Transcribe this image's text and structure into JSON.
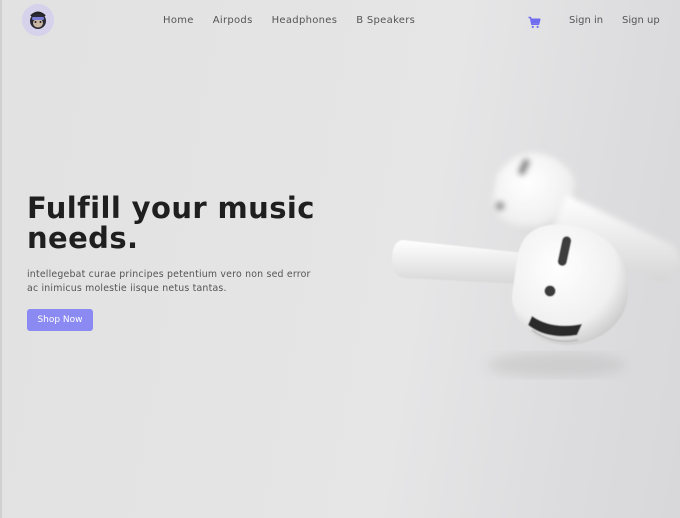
{
  "nav": {
    "links": [
      "Home",
      "Airpods",
      "Headphones",
      "B Speakers"
    ],
    "sign_in": "Sign in",
    "sign_up": "Sign up"
  },
  "icons": {
    "logo": "monkey-mascot-logo",
    "cart": "shopping-cart-icon"
  },
  "hero": {
    "headline_line1": "Fulfill your music",
    "headline_line2": "needs.",
    "description": "intellegebat curae principes petentium vero non sed error ac inimicus molestie iisque netus tantas.",
    "cta_label": "Shop Now"
  },
  "colors": {
    "accent": "#8a8af2",
    "cart": "#6f6cf0",
    "headline": "#1f1f1f",
    "background": "#e4e4e4"
  }
}
